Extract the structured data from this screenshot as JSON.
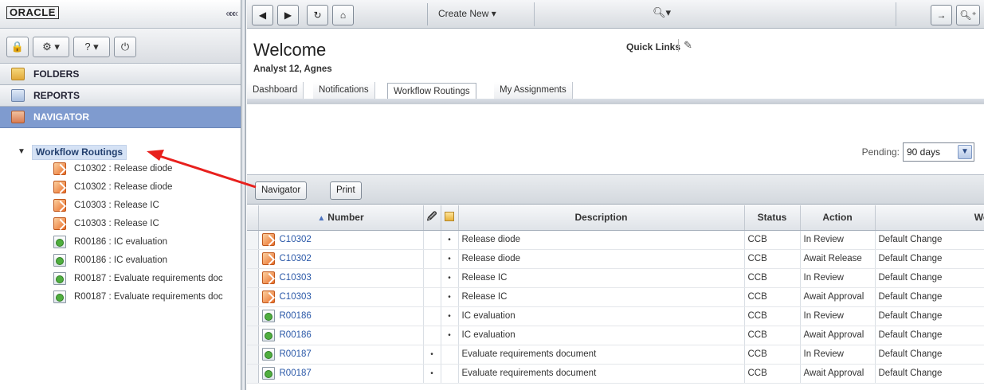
{
  "brand": {
    "logo": "ORACLE",
    "collapse_glyph": "«««"
  },
  "left_toolbar": {
    "lock_glyph": "🔒",
    "gear_label": "⚙ ▾",
    "help_label": "? ▾",
    "power_glyph": "⏻"
  },
  "accordion": [
    {
      "label": "FOLDERS"
    },
    {
      "label": "REPORTS"
    },
    {
      "label": "NAVIGATOR"
    }
  ],
  "tree": {
    "root": "Workflow Routings",
    "nodes": [
      {
        "label": "C10302 : Release diode",
        "icon": "change"
      },
      {
        "label": "C10302 : Release diode",
        "icon": "change"
      },
      {
        "label": "C10303 : Release IC",
        "icon": "change"
      },
      {
        "label": "C10303 : Release IC",
        "icon": "change"
      },
      {
        "label": "R00186 : IC evaluation",
        "icon": "doc"
      },
      {
        "label": "R00186 : IC evaluation",
        "icon": "doc"
      },
      {
        "label": "R00187 : Evaluate requirements doc",
        "icon": "doc"
      },
      {
        "label": "R00187 : Evaluate requirements doc",
        "icon": "doc"
      }
    ]
  },
  "topbar": {
    "back": "◀",
    "forward": "▶",
    "refresh": "↻",
    "home": "⌂",
    "create_new": "Create New ▾",
    "search_glyph": "🔍︎▾",
    "right1": "→",
    "right2": "🔍︎⁺"
  },
  "welcome": {
    "title": "Welcome",
    "user": "Analyst 12, Agnes",
    "quick_links": "Quick Links",
    "pencil": "✎"
  },
  "tabs": [
    "Dashboard",
    "Notifications",
    "Workflow Routings",
    "My Assignments"
  ],
  "pending": {
    "label": "Pending:",
    "value": "90 days",
    "arrow": "▼"
  },
  "grid_toolbar": {
    "navigator": "Navigator",
    "print": "Print"
  },
  "grid": {
    "headers": {
      "number": "Number",
      "sort_glyph": "▲",
      "attach_glyph": "🖉",
      "description": "Description",
      "status": "Status",
      "action": "Action",
      "workflow": "Work"
    },
    "rows": [
      {
        "number": "C10302",
        "icon": "change",
        "attach": "",
        "bullet": "•",
        "description": "Release diode",
        "status": "CCB",
        "action": "In Review",
        "workflow": "Default Change"
      },
      {
        "number": "C10302",
        "icon": "change",
        "attach": "",
        "bullet": "•",
        "description": "Release diode",
        "status": "CCB",
        "action": "Await Release",
        "workflow": "Default Change"
      },
      {
        "number": "C10303",
        "icon": "change",
        "attach": "",
        "bullet": "•",
        "description": "Release IC",
        "status": "CCB",
        "action": "In Review",
        "workflow": "Default Change"
      },
      {
        "number": "C10303",
        "icon": "change",
        "attach": "",
        "bullet": "•",
        "description": "Release IC",
        "status": "CCB",
        "action": "Await Approval",
        "workflow": "Default Change"
      },
      {
        "number": "R00186",
        "icon": "doc",
        "attach": "",
        "bullet": "•",
        "description": "IC evaluation",
        "status": "CCB",
        "action": "In Review",
        "workflow": "Default Change"
      },
      {
        "number": "R00186",
        "icon": "doc",
        "attach": "",
        "bullet": "•",
        "description": "IC evaluation",
        "status": "CCB",
        "action": "Await Approval",
        "workflow": "Default Change"
      },
      {
        "number": "R00187",
        "icon": "doc",
        "attach": "•",
        "bullet": "",
        "description": "Evaluate requirements document",
        "status": "CCB",
        "action": "In Review",
        "workflow": "Default Change"
      },
      {
        "number": "R00187",
        "icon": "doc",
        "attach": "•",
        "bullet": "",
        "description": "Evaluate requirements document",
        "status": "CCB",
        "action": "Await Approval",
        "workflow": "Default Change"
      }
    ]
  },
  "colors": {
    "accent": "#7f9bcf",
    "link": "#2a58a8",
    "annotation_arrow": "#e8201d"
  }
}
